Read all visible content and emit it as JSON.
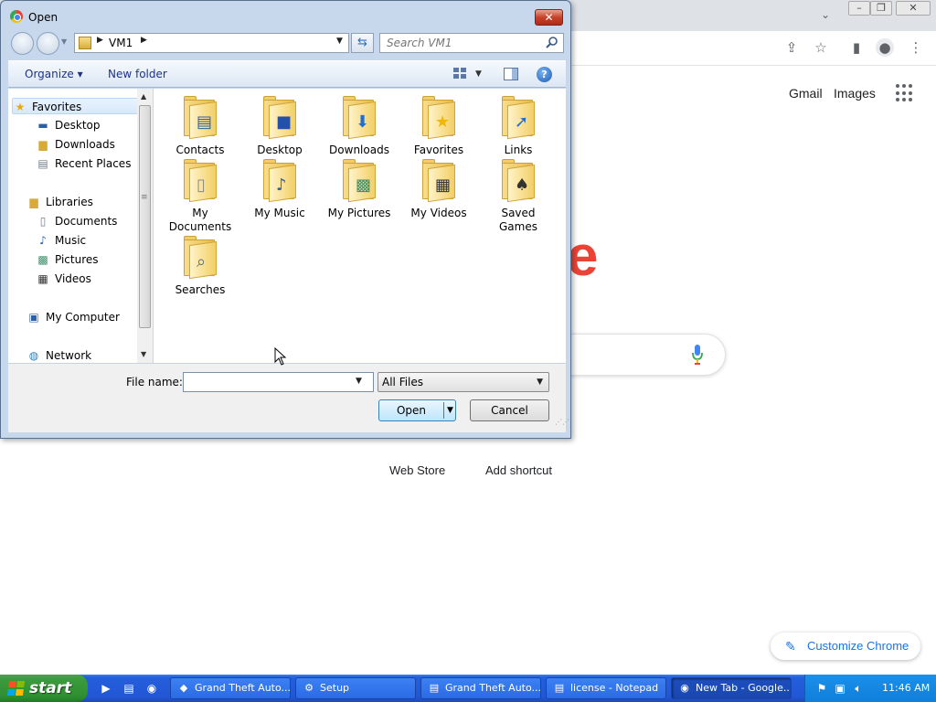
{
  "chrome": {
    "header_links": [
      "Gmail",
      "Images"
    ],
    "logo_letter": "e",
    "shortcuts": [
      "Web Store",
      "Add shortcut"
    ],
    "customize_label": "Customize Chrome",
    "accent_color": "#1a73e8"
  },
  "dialog": {
    "title": "Open",
    "close_label": "✕",
    "address": {
      "crumb": "VM1"
    },
    "search": {
      "placeholder": "Search VM1"
    },
    "toolbar": {
      "organize_label": "Organize ▾",
      "new_folder_label": "New folder",
      "help_label": "?"
    },
    "nav": {
      "favorites": "Favorites",
      "favorites_items": [
        "Desktop",
        "Downloads",
        "Recent Places"
      ],
      "libraries": "Libraries",
      "libraries_items": [
        "Documents",
        "Music",
        "Pictures",
        "Videos"
      ],
      "computer": "My Computer",
      "network": "Network"
    },
    "files": [
      {
        "label": "Contacts",
        "icon": "contacts-icon"
      },
      {
        "label": "Desktop",
        "icon": "desktop-icon"
      },
      {
        "label": "Downloads",
        "icon": "downloads-icon"
      },
      {
        "label": "Favorites",
        "icon": "star-icon"
      },
      {
        "label": "Links",
        "icon": "link-arrow-icon"
      },
      {
        "label": "My\nDocuments",
        "icon": "documents-icon"
      },
      {
        "label": "My Music",
        "icon": "music-note-icon"
      },
      {
        "label": "My Pictures",
        "icon": "picture-icon"
      },
      {
        "label": "My Videos",
        "icon": "film-icon"
      },
      {
        "label": "Saved\nGames",
        "icon": "chess-icon"
      },
      {
        "label": "Searches",
        "icon": "magnifier-icon"
      }
    ],
    "filename": {
      "label": "File name:",
      "value": ""
    },
    "filetype": {
      "value": "All Files"
    },
    "buttons": {
      "open": "Open",
      "cancel": "Cancel"
    }
  },
  "taskbar": {
    "start_label": "start",
    "tasks": [
      {
        "label": "Grand Theft Auto...",
        "active": false
      },
      {
        "label": "Setup",
        "active": false
      },
      {
        "label": "Grand Theft Auto...",
        "active": false
      },
      {
        "label": "license - Notepad",
        "active": false
      },
      {
        "label": "New Tab - Google...",
        "active": true
      }
    ],
    "clock": "11:46 AM"
  }
}
